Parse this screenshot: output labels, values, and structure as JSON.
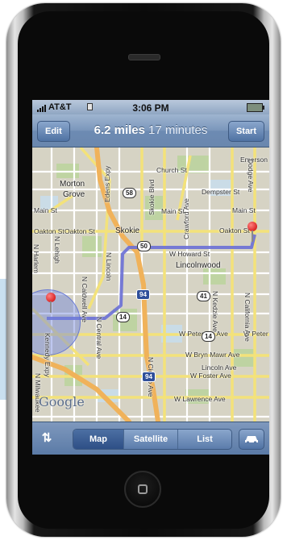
{
  "status_bar": {
    "carrier": "AT&T",
    "time": "3:06 PM"
  },
  "nav_bar": {
    "edit_label": "Edit",
    "distance": "6.2 miles",
    "duration": "17 minutes",
    "start_label": "Start"
  },
  "map": {
    "towns": {
      "morton_grove_1": "Morton",
      "morton_grove_2": "Grove",
      "skokie": "Skokie",
      "lincolnwood": "Lincolnwood"
    },
    "streets": {
      "church": "Church St",
      "emerson": "Emerson",
      "dempster": "Dempster St",
      "main_w": "Main St",
      "main_e": "Main St",
      "oakton_w": "Oakton St",
      "oakton_m": "Oakton St",
      "oakton_e": "Oakton St",
      "howard": "W Howard St",
      "peterson_w": "W Peterson Ave",
      "peterson_e": "W Peter",
      "bryn_mawr": "W Bryn Mawr Ave",
      "foster": "W Foster Ave",
      "lawrence": "W Lawrence Ave",
      "lincoln": "N Lincoln",
      "caldwell": "N Caldwell Ave",
      "central": "N Central Ave",
      "cicero": "N Cicero Ave",
      "kedzie": "N Kedzie Ave",
      "california": "N California Ave",
      "crawford": "Crawford Ave",
      "skokie_blvd": "Skokie Blvd",
      "edens": "Edens Expy",
      "dodge": "Dodge Ave",
      "kennedy": "Kennedy Expy",
      "milwaukee": "N Milwaukee",
      "harlem": "N Harlem",
      "lehigh": "N Lehigh",
      "lincoln_ave": "Lincoln Ave"
    },
    "shields": {
      "rt58": "58",
      "rt50": "50",
      "i94_a": "94",
      "rt41": "41",
      "rt14_a": "14",
      "rt14_b": "14",
      "i94_b": "94"
    },
    "attribution": "Google"
  },
  "tab_bar": {
    "swap_icon": "⇅",
    "map_label": "Map",
    "satellite_label": "Satellite",
    "list_label": "List",
    "car_icon": "car-icon"
  },
  "colors": {
    "nav_blue": "#6d8bb3",
    "route": "#6a6fd6",
    "expressway": "#f0b25a",
    "pin": "#d40000"
  }
}
